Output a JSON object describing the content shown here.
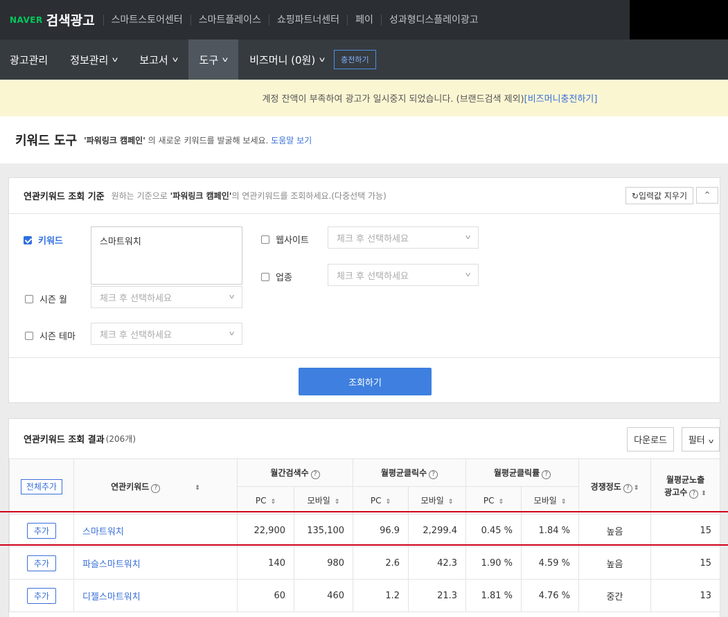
{
  "topbar": {
    "logo_naver": "NAVER",
    "logo_title": "검색광고",
    "links": [
      "스마트스토어센터",
      "스마트플레이스",
      "쇼핑파트너센터",
      "페이",
      "성과형디스플레이광고"
    ]
  },
  "nav": {
    "items": [
      "광고관리",
      "정보관리",
      "보고서",
      "도구",
      "비즈머니 (0원)"
    ],
    "charge_label": "충전하기"
  },
  "notice": {
    "text": "계정 잔액이 부족하여 광고가 일시중지 되었습니다. (브랜드검색 제외)",
    "link": "[비즈머니충전하기]"
  },
  "page": {
    "title": "키워드 도구",
    "campaign": "'파워링크 캠페인'",
    "desc": " 의 새로운 키워드를 발굴해 보세요. ",
    "help_link": "도움말 보기"
  },
  "criteria": {
    "title": "연관키워드 조회 기준",
    "desc_pre": "원하는 기준으로 ",
    "desc_campaign": "'파워링크 캠페인'",
    "desc_post": "의 연관키워드를 조회하세요.(다중선택 가능)",
    "reset_label": "입력값 지우기",
    "keyword_label": "키워드",
    "keyword_value": "스마트워치",
    "website_label": "웹사이트",
    "industry_label": "업종",
    "season_month_label": "시즌 월",
    "season_theme_label": "시즌 테마",
    "select_placeholder": "체크 후 선택하세요",
    "search_label": "조회하기"
  },
  "results": {
    "title": "연관키워드 조회 결과",
    "count": "(206개)",
    "download_label": "다운로드",
    "filter_label": "필터",
    "add_all_label": "전체추가",
    "headers": {
      "keyword": "연관키워드",
      "monthly_search": "월간검색수",
      "monthly_clicks": "월평균클릭수",
      "monthly_ctr": "월평균클릭률",
      "competition": "경쟁정도",
      "ad_count_line1": "월평균노출",
      "ad_count_line2": "광고수",
      "pc": "PC",
      "mobile": "모바일"
    },
    "add_label": "추가",
    "rows": [
      {
        "keyword": "스마트워치",
        "search_pc": "22,900",
        "search_mobile": "135,100",
        "click_pc": "96.9",
        "click_mobile": "2,299.4",
        "ctr_pc": "0.45 %",
        "ctr_mobile": "1.84 %",
        "competition": "높음",
        "ad_count": "15"
      },
      {
        "keyword": "파슬스마트워치",
        "search_pc": "140",
        "search_mobile": "980",
        "click_pc": "2.6",
        "click_mobile": "42.3",
        "ctr_pc": "1.90 %",
        "ctr_mobile": "4.59 %",
        "competition": "높음",
        "ad_count": "15"
      },
      {
        "keyword": "디젤스마트워치",
        "search_pc": "60",
        "search_mobile": "460",
        "click_pc": "1.2",
        "click_mobile": "21.3",
        "ctr_pc": "1.81 %",
        "ctr_mobile": "4.76 %",
        "competition": "중간",
        "ad_count": "13"
      }
    ]
  }
}
